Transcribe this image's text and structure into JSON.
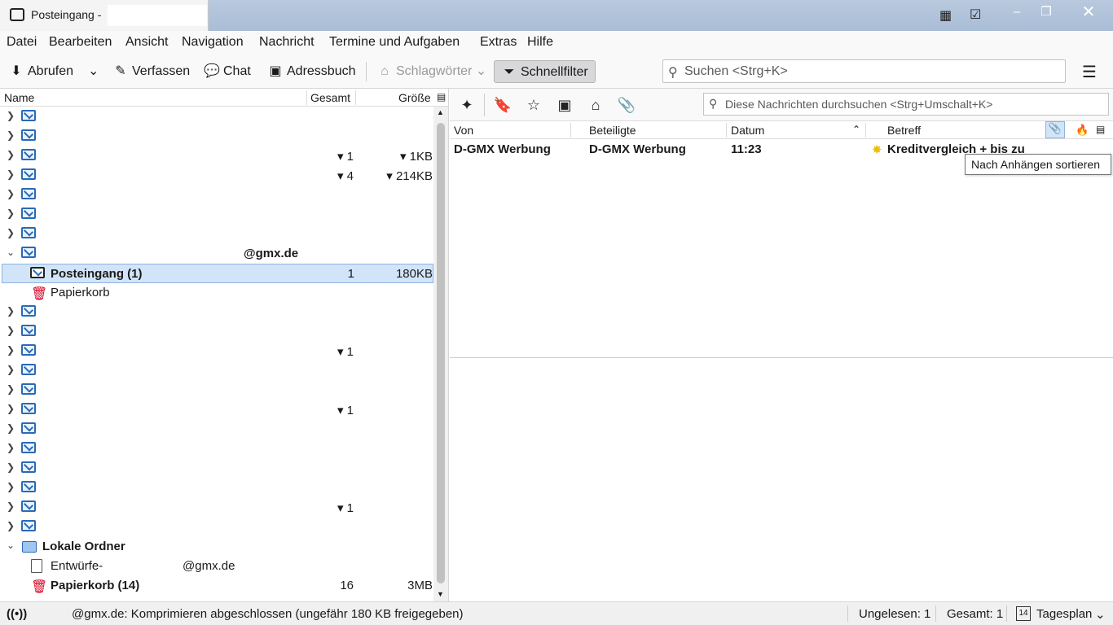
{
  "window": {
    "title": "Posteingang -"
  },
  "menu": [
    "Datei",
    "Bearbeiten",
    "Ansicht",
    "Navigation",
    "Nachricht",
    "Termine und Aufgaben",
    "Extras",
    "Hilfe"
  ],
  "toolbar": {
    "get_mail": "Abrufen",
    "compose": "Verfassen",
    "chat": "Chat",
    "addressbook": "Adressbuch",
    "tags": "Schlagwörter",
    "quickfilter": "Schnellfilter",
    "search_placeholder": "Suchen <Strg+K>"
  },
  "folder_pane": {
    "columns": {
      "name": "Name",
      "total": "Gesamt",
      "size": "Größe"
    },
    "account_rows": [
      {
        "total": "",
        "size": ""
      },
      {
        "total": "",
        "size": ""
      },
      {
        "total": "▾ 1",
        "size": "▾ 1KB"
      },
      {
        "total": "▾ 4",
        "size": "▾ 214KB"
      },
      {
        "total": "",
        "size": ""
      },
      {
        "total": "",
        "size": ""
      },
      {
        "total": "",
        "size": ""
      }
    ],
    "expanded_account": "@gmx.de",
    "inbox": {
      "label": "Posteingang (1)",
      "total": "1",
      "size": "180KB"
    },
    "trash": {
      "label": "Papierkorb"
    },
    "more_rows": [
      {
        "total": ""
      },
      {
        "total": ""
      },
      {
        "total": "▾ 1"
      },
      {
        "total": ""
      },
      {
        "total": ""
      },
      {
        "total": "▾ 1"
      },
      {
        "total": ""
      },
      {
        "total": ""
      },
      {
        "total": ""
      },
      {
        "total": ""
      },
      {
        "total": "▾ 1"
      },
      {
        "total": ""
      }
    ],
    "local_folders": "Lokale Ordner",
    "drafts": {
      "prefix": "Entwürfe-",
      "suffix": "@gmx.de"
    },
    "local_trash": {
      "label": "Papierkorb (14)",
      "total": "16",
      "size": "3MB"
    }
  },
  "quick_filter": {
    "search_placeholder": "Diese Nachrichten durchsuchen <Strg+Umschalt+K>"
  },
  "thread_pane": {
    "columns": {
      "from": "Von",
      "participants": "Beteiligte",
      "date": "Datum",
      "subject": "Betreff"
    },
    "messages": [
      {
        "from": "D-GMX Werbung",
        "participants": "D-GMX Werbung",
        "date": "11:23",
        "subject": "Kreditvergleich + bis zu"
      }
    ],
    "tooltip": "Nach Anhängen sortieren"
  },
  "status": {
    "message": "@gmx.de: Komprimieren abgeschlossen (ungefähr 180 KB freigegeben)",
    "unread": "Ungelesen: 1",
    "total": "Gesamt: 1",
    "today_pane": "Tagesplan",
    "calendar_day": "14"
  },
  "colors": {
    "accent": "#2a6ab6",
    "selection": "#d2e4f8",
    "trash_red": "#d70022"
  }
}
